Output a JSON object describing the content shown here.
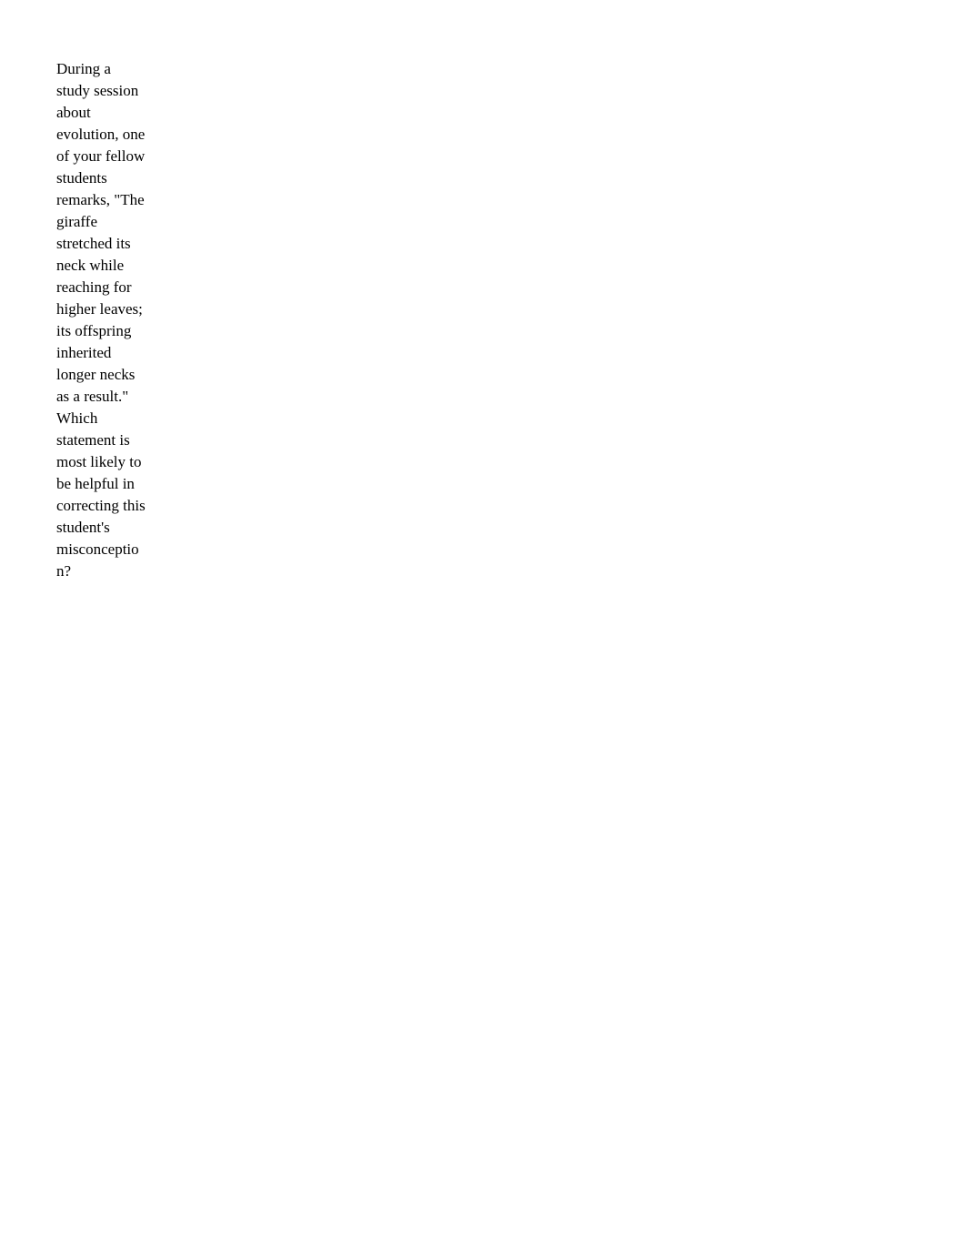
{
  "document": {
    "background_color": "#ffffff",
    "text_color": "#000000",
    "question": {
      "label": "evolution-misconception-question",
      "text": "During a study session about evolution, one of your fellow students remarks, \"The giraffe stretched its neck while reaching for higher leaves; its offspring inherited longer necks as a result.\" Which statement is most likely to be helpful in correcting this student's misconception?",
      "rendered_lines": [
        "During a",
        "study session",
        "about",
        "evolution,",
        "one of your",
        "fellow",
        "students",
        "remarks,",
        "\"The giraffe",
        "stretched its",
        "neck while",
        "reaching for",
        "higher leaves;",
        "its offspring",
        "inherited",
        "longer necks",
        "as a result.\"",
        "Which",
        "statement is",
        "most likely to",
        "be helpful in",
        "correcting",
        "this student's",
        "misconceptio",
        "n?"
      ]
    }
  }
}
